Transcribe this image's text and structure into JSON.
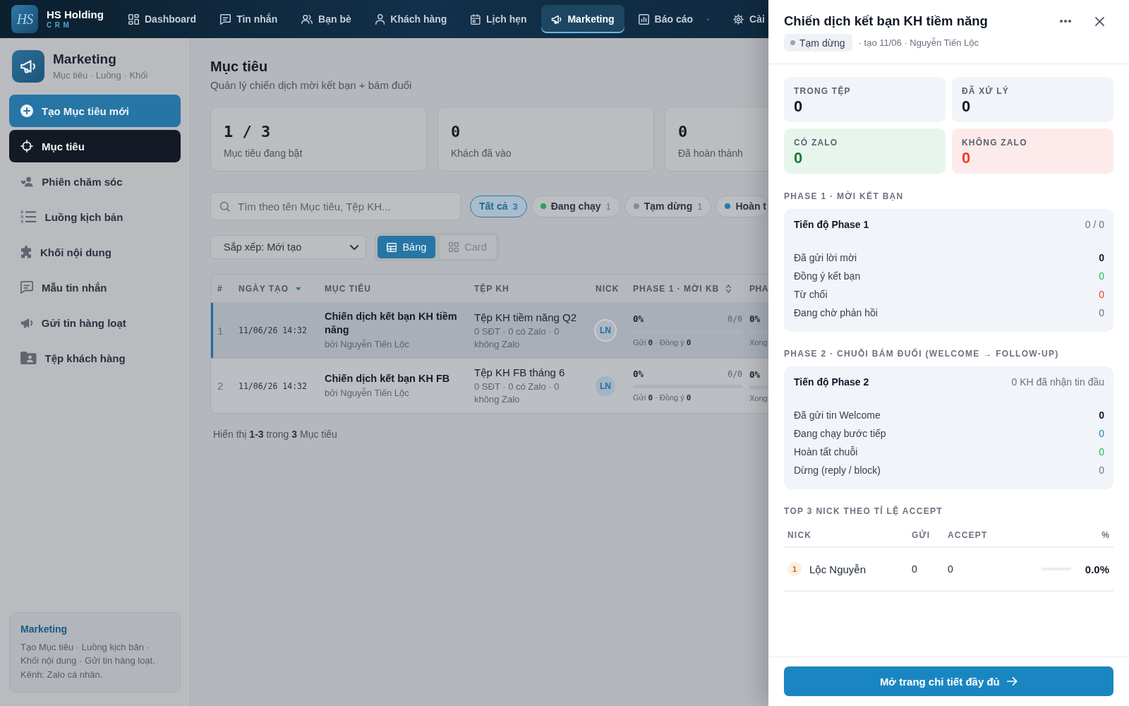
{
  "top_nav": {
    "brand": {
      "mark": "HS",
      "name": "HS Holding",
      "tagline": "CRM"
    },
    "items": [
      {
        "label": "Dashboard",
        "selected": false
      },
      {
        "label": "Tin nhắn",
        "selected": false
      },
      {
        "label": "Bạn bè",
        "selected": false
      },
      {
        "label": "Khách hàng",
        "selected": false
      },
      {
        "label": "Lịch hẹn",
        "selected": false
      },
      {
        "label": "Marketing",
        "selected": true
      },
      {
        "label": "Báo cáo",
        "selected": false
      }
    ],
    "trailing_items": [
      {
        "label": "Cài",
        "selected": false
      }
    ]
  },
  "sidebar": {
    "header": {
      "title": "Marketing",
      "subtitle": "Mục tiêu · Luồng · Khối"
    },
    "create_button": "Tạo Mục tiêu mới",
    "items": [
      {
        "label": "Mục tiêu",
        "selected": true
      },
      {
        "label": "Phiên chăm sóc",
        "selected": false
      },
      {
        "label": "Luồng kịch bản",
        "selected": false
      },
      {
        "label": "Khối nội dung",
        "selected": false
      },
      {
        "label": "Mẫu tin nhắn",
        "selected": false
      },
      {
        "label": "Gửi tin hàng loạt",
        "selected": false
      },
      {
        "label": "Tệp khách hàng",
        "selected": false
      }
    ],
    "info_card": {
      "title": "Marketing",
      "text": "Tạo Mục tiêu · Luồng kịch bản · Khối nội dung · Gửi tin hàng loạt. Kênh: Zalo cá nhân."
    }
  },
  "page": {
    "title": "Mục tiêu",
    "subtitle": "Quản lý chiến dịch mời kết bạn + bám đuổi",
    "stats": [
      {
        "value": "1 / 3",
        "label": "Mục tiêu đang bật"
      },
      {
        "value": "0",
        "label": "Khách đã vào"
      },
      {
        "value": "0",
        "label": "Đã hoàn thành"
      }
    ],
    "search": {
      "placeholder": "Tìm theo tên Mục tiêu, Tệp KH..."
    },
    "filters": [
      {
        "label": "Tất cả",
        "count": "3",
        "selected": true
      },
      {
        "label": "Đang chạy",
        "count": "1",
        "selected": false,
        "color": "#2a9f5a"
      },
      {
        "label": "Tạm dừng",
        "count": "1",
        "selected": false,
        "color": "#868c95"
      },
      {
        "label": "Hoàn t",
        "selected": false,
        "color": "#1f7cb3"
      }
    ],
    "sort": {
      "value": "Sắp xếp: Mới tạo"
    },
    "view_toggle": [
      {
        "label": "Bảng",
        "selected": true
      },
      {
        "label": "Card",
        "selected": false
      }
    ],
    "table": {
      "columns": [
        {
          "label": "#",
          "sorted": false,
          "sortable": false
        },
        {
          "label": "NGÀY TẠO",
          "sorted": true,
          "sortable": false
        },
        {
          "label": "MỤC TIÊU",
          "sorted": false,
          "sortable": false
        },
        {
          "label": "TỆP KH",
          "sorted": false,
          "sortable": false
        },
        {
          "label": "NICK",
          "sorted": false,
          "sortable": false
        },
        {
          "label": "PHASE 1 · MỜI KB",
          "sorted": false,
          "sortable": true
        },
        {
          "label": "PHA",
          "sorted": false,
          "sortable": false
        }
      ],
      "rows": [
        {
          "index": "1",
          "date": "11/06/26 14:32",
          "goal": "Chiến dịch kết bạn KH tiềm năng",
          "owner": "bởi Nguyễn Tiến Lộc",
          "file": "Tệp KH tiềm năng Q2",
          "file_stats": "0 SĐT · 0 có Zalo · 0 không Zalo",
          "nick": "LN",
          "phase_1": {
            "percent": "0%",
            "count": "0/0",
            "level": 0,
            "detail": "Gửi **0** · Đồng ý **0**"
          },
          "column_7": {
            "percent": "0%",
            "level": 0,
            "detail": "Xong"
          },
          "selected": true
        },
        {
          "index": "2",
          "date": "11/06/26 14:32",
          "goal": "Chiến dịch kết bạn KH FB",
          "owner": "bởi Nguyễn Tiến Lộc",
          "file": "Tệp KH FB tháng 6",
          "file_stats": "0 SĐT · 0 có Zalo · 0 không Zalo",
          "nick": "LN",
          "phase_1": {
            "percent": "0%",
            "count": "0/0",
            "level": 0,
            "detail": "Gửi **0** · Đồng ý **0**"
          },
          "column_7": {
            "percent": "0%",
            "level": 0,
            "detail": "Xong"
          },
          "selected": false
        }
      ]
    },
    "footer": "Hiển thị **1-3** trong **3** Mục tiêu"
  },
  "drawer": {
    "title": "Chiến dịch kết bạn KH tiềm năng",
    "status": {
      "label": "Tạm dừng",
      "color": "#9ca3af"
    },
    "meta": "· tạo 11/06 · Nguyễn Tiến Lộc",
    "stats": [
      {
        "label": "TRONG TỆP",
        "value": "0",
        "kind": "plain"
      },
      {
        "label": "ĐÃ XỬ LÝ",
        "value": "0",
        "kind": "plain"
      },
      {
        "label": "CÓ ZALO",
        "value": "0",
        "kind": "positive"
      },
      {
        "label": "KHÔNG ZALO",
        "value": "0",
        "kind": "negative"
      }
    ],
    "phases": [
      {
        "heading": "PHASE 1 · MỜI KẾT BẠN",
        "title": "Tiến độ Phase 1",
        "summary": "0 / 0",
        "rows": [
          {
            "label": "Đã gửi lời mời",
            "value": "0",
            "kind": "strong"
          },
          {
            "label": "Đồng ý kết bạn",
            "value": "0",
            "kind": "positive"
          },
          {
            "label": "Từ chối",
            "value": "0",
            "kind": "negative"
          },
          {
            "label": "Đang chờ phản hồi",
            "value": "0",
            "kind": "muted"
          }
        ]
      },
      {
        "heading": "PHASE 2 · CHUỖI BÁM ĐUỔI (WELCOME → FOLLOW-UP)",
        "title": "Tiến độ Phase 2",
        "summary": "0 KH đã nhận tin đầu",
        "rows": [
          {
            "label": "Đã gửi tin Welcome",
            "value": "0",
            "kind": "strong"
          },
          {
            "label": "Đang chạy bước tiếp",
            "value": "0",
            "kind": "info"
          },
          {
            "label": "Hoàn tất chuỗi",
            "value": "0",
            "kind": "positive"
          },
          {
            "label": "Dừng (reply / block)",
            "value": "0",
            "kind": "muted"
          }
        ]
      }
    ],
    "top_nicks": {
      "heading": "TOP 3 NICK THEO TỈ LỆ ACCEPT",
      "columns": [
        "NICK",
        "GỬI",
        "ACCEPT",
        "%"
      ],
      "rows": [
        {
          "rank": "1",
          "name": "Lộc Nguyễn",
          "sent": "0",
          "accepted": "0",
          "level": 0,
          "percent": "0.0%"
        }
      ]
    },
    "open_button": "Mở trang chi tiết đầy đủ"
  }
}
